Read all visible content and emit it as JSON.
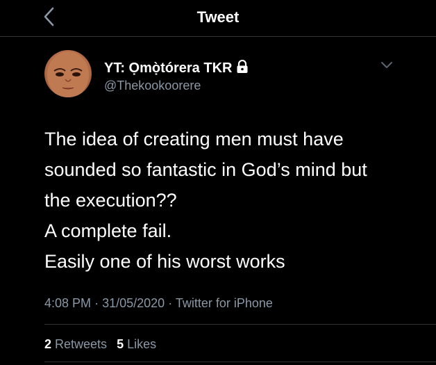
{
  "header": {
    "title": "Tweet",
    "back_icon": "chevron-left-icon"
  },
  "author": {
    "display_name": "YT: Ọmọ̀tórera TKR",
    "lock_icon": "lock-icon",
    "handle": "@Thekookoorere",
    "caret_icon": "chevron-down-icon"
  },
  "tweet": {
    "lines": [
      "The idea of creating men must have",
      "sounded so fantastic in God’s mind but",
      "the execution??",
      "A complete fail.",
      "Easily one of his worst works"
    ]
  },
  "meta": {
    "time": "4:08 PM",
    "separator": "·",
    "date": "31/05/2020",
    "source": "Twitter for iPhone"
  },
  "stats": {
    "retweets_count": "2",
    "retweets_label": "Retweets",
    "likes_count": "5",
    "likes_label": "Likes"
  },
  "colors": {
    "background": "#000000",
    "text": "#ffffff",
    "secondary_text": "#8b98a5",
    "divider": "#2f3336"
  }
}
